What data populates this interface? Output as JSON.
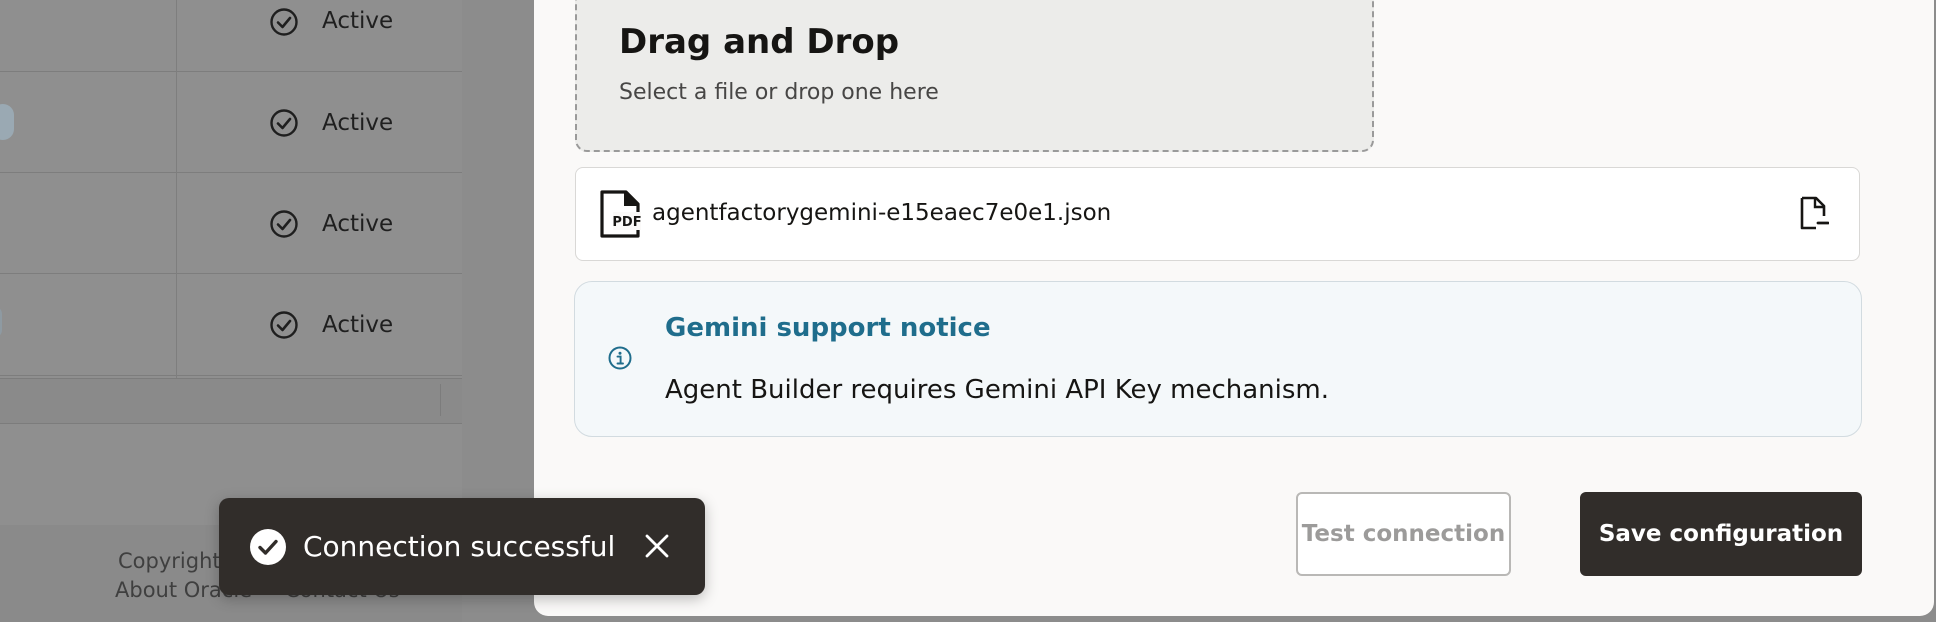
{
  "background": {
    "rows": [
      {
        "status": "Active"
      },
      {
        "status": "Active"
      },
      {
        "status": "Active"
      },
      {
        "status": "Active"
      }
    ],
    "footer": {
      "copyright": "Copyright",
      "about": "About Oracle",
      "contact": "Contact Us"
    }
  },
  "upload": {
    "title": "Drag and Drop",
    "subtitle": "Select a file or drop one here",
    "file_name": "agentfactorygemini-e15eaec7e0e1.json",
    "file_icon": "pdf-file-icon",
    "remove_icon": "file-remove-icon"
  },
  "notice": {
    "title": "Gemini support notice",
    "body": "Agent Builder requires Gemini API Key mechanism.",
    "icon": "info-icon",
    "accent": "#1f6d8c"
  },
  "actions": {
    "test_label": "Test connection",
    "save_label": "Save configuration"
  },
  "toast": {
    "message": "Connection successful",
    "icon": "check-circle-icon",
    "close_icon": "close-icon"
  },
  "colors": {
    "primary_button": "#312d2a",
    "toast_bg": "#312d2a",
    "notice_bg": "#f4f8fa"
  }
}
